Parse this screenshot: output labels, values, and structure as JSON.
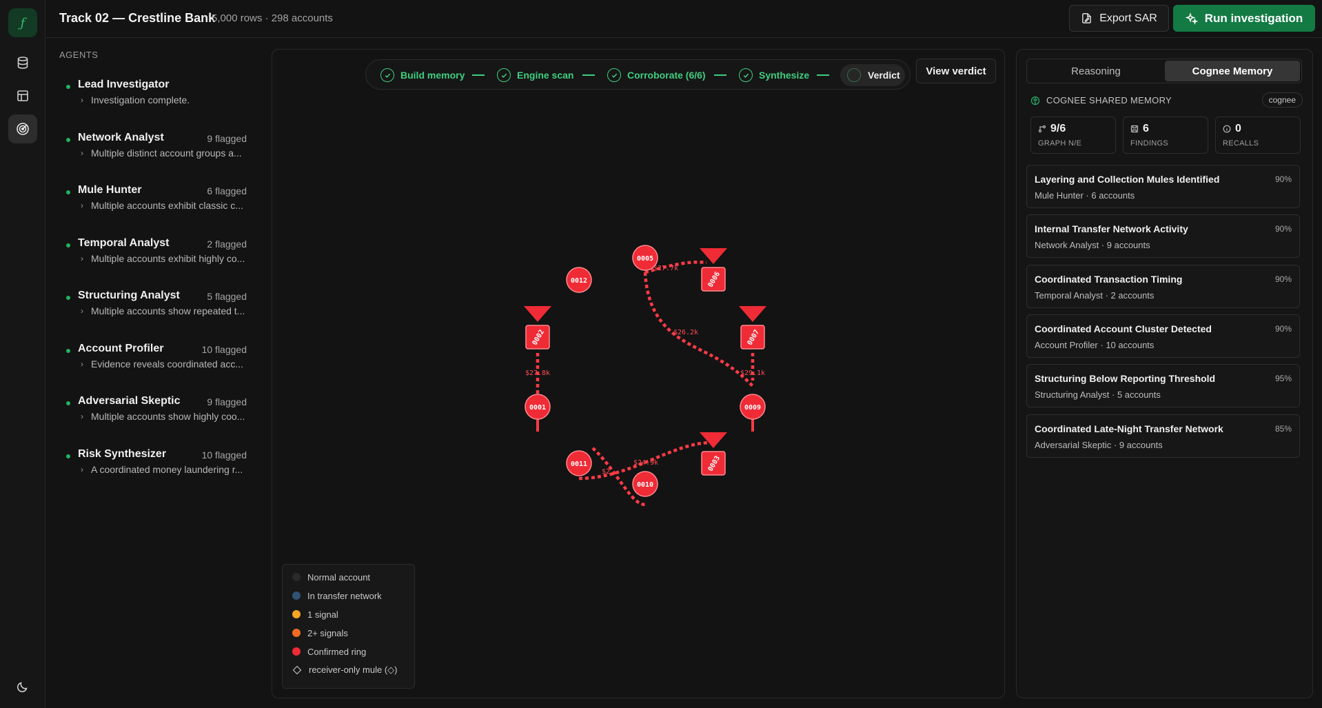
{
  "app": {
    "logo": "ƒ",
    "title": "Track 02 — Crestline Bank",
    "subtitle": "5,000 rows · 298 accounts",
    "export_label": "Export SAR",
    "run_label": "Run investigation"
  },
  "rail": {
    "items": [
      {
        "icon": "database-icon"
      },
      {
        "icon": "table-icon"
      },
      {
        "icon": "radar-icon",
        "active": true
      }
    ],
    "bottom_icon": "moon-icon"
  },
  "agents": {
    "heading": "AGENTS",
    "items": [
      {
        "name": "Lead Investigator",
        "count": "",
        "summary": "Investigation complete."
      },
      {
        "name": "Network Analyst",
        "count": "9 flagged",
        "summary": "Multiple distinct account groups a..."
      },
      {
        "name": "Mule Hunter",
        "count": "6 flagged",
        "summary": "Multiple accounts exhibit classic c..."
      },
      {
        "name": "Temporal Analyst",
        "count": "2 flagged",
        "summary": "Multiple accounts exhibit highly co..."
      },
      {
        "name": "Structuring Analyst",
        "count": "5 flagged",
        "summary": "Multiple accounts show repeated t..."
      },
      {
        "name": "Account Profiler",
        "count": "10 flagged",
        "summary": "Evidence reveals coordinated acc..."
      },
      {
        "name": "Adversarial Skeptic",
        "count": "9 flagged",
        "summary": "Multiple accounts show highly coo..."
      },
      {
        "name": "Risk Synthesizer",
        "count": "10 flagged",
        "summary": "A coordinated money laundering r..."
      }
    ]
  },
  "pipeline": {
    "steps": [
      "Build memory",
      "Engine scan",
      "Corroborate (6/6)",
      "Synthesize"
    ],
    "current": "Verdict",
    "view_label": "View verdict"
  },
  "graph": {
    "nodes": [
      {
        "id": "0005",
        "shape": "circle"
      },
      {
        "id": "0006",
        "shape": "square"
      },
      {
        "id": "0012",
        "shape": "circle"
      },
      {
        "id": "0002",
        "shape": "square"
      },
      {
        "id": "0007",
        "shape": "square"
      },
      {
        "id": "0001",
        "shape": "circle"
      },
      {
        "id": "0009",
        "shape": "circle"
      },
      {
        "id": "0011",
        "shape": "circle"
      },
      {
        "id": "0003",
        "shape": "square"
      },
      {
        "id": "0010",
        "shape": "circle"
      }
    ],
    "edges": [
      {
        "from": "0005",
        "to": "0006",
        "label": "$27.7k"
      },
      {
        "from": "0005",
        "to": "0007",
        "label": "$26.2k"
      },
      {
        "from": "0002",
        "to": "0001",
        "label": "$27.8k"
      },
      {
        "from": "0007",
        "to": "0009",
        "label": "$29.1k"
      },
      {
        "from": "0011",
        "to": "0003",
        "label": "$24.9k"
      },
      {
        "from": "0011",
        "to": "0010",
        "label": "$2"
      }
    ],
    "colors": {
      "confirmed": "#ef2b36",
      "edge": "#ff3b45"
    }
  },
  "legend": {
    "items": [
      {
        "label": "Normal account",
        "color": "#2a2a2a"
      },
      {
        "label": "In transfer network",
        "color": "#2f5373"
      },
      {
        "label": "1 signal",
        "color": "#f5a623"
      },
      {
        "label": "2+ signals",
        "color": "#f26a24"
      },
      {
        "label": "Confirmed ring",
        "color": "#ef2b36"
      },
      {
        "label": "receiver-only mule (◇)",
        "color": ""
      }
    ]
  },
  "panel": {
    "tabs": [
      "Reasoning",
      "Cognee Memory"
    ],
    "active_tab": 1,
    "memory_heading": "COGNEE SHARED MEMORY",
    "memory_badge": "cognee",
    "stats": [
      {
        "value": "9/6",
        "label": "GRAPH N/E",
        "icon": "graph-icon"
      },
      {
        "value": "6",
        "label": "FINDINGS",
        "icon": "save-icon"
      },
      {
        "value": "0",
        "label": "RECALLS",
        "icon": "info-icon"
      }
    ],
    "findings": [
      {
        "title": "Layering and Collection Mules Identified",
        "sub": "Mule Hunter · 6 accounts",
        "pct": "90%"
      },
      {
        "title": "Internal Transfer Network Activity",
        "sub": "Network Analyst · 9 accounts",
        "pct": "90%"
      },
      {
        "title": "Coordinated Transaction Timing",
        "sub": "Temporal Analyst · 2 accounts",
        "pct": "90%"
      },
      {
        "title": "Coordinated Account Cluster Detected",
        "sub": "Account Profiler · 10 accounts",
        "pct": "90%"
      },
      {
        "title": "Structuring Below Reporting Threshold",
        "sub": "Structuring Analyst · 5 accounts",
        "pct": "95%"
      },
      {
        "title": "Coordinated Late-Night Transfer Network",
        "sub": "Adversarial Skeptic · 9 accounts",
        "pct": "85%"
      }
    ]
  }
}
